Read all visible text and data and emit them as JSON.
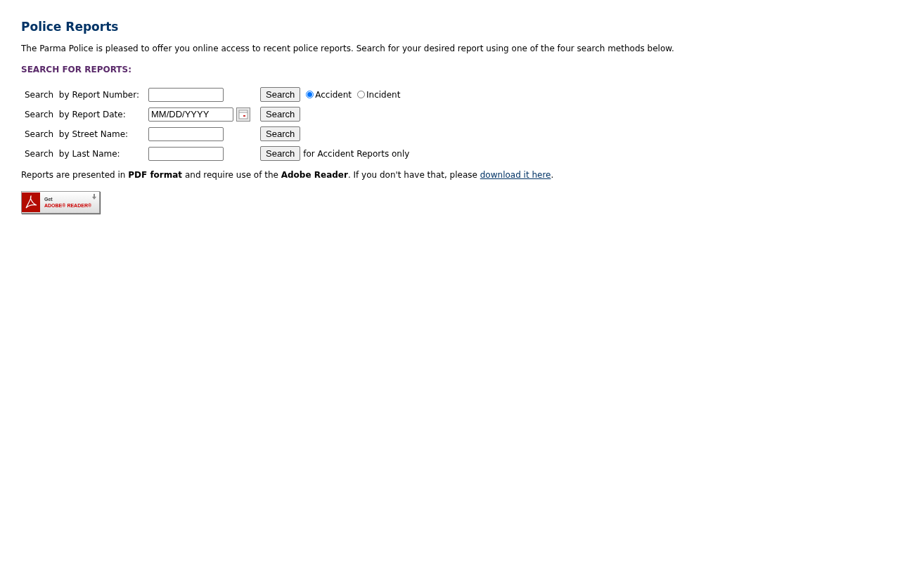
{
  "title": "Police Reports",
  "intro": "The Parma Police is pleased to offer you online access to recent police reports. Search for your desired report using one of the four search methods below.",
  "section_heading": "SEARCH FOR REPORTS:",
  "search_rows": [
    {
      "label": "Search  by Report Number:",
      "kind": "text",
      "button": "Search",
      "options": [
        {
          "label": "Accident",
          "selected": true
        },
        {
          "label": "Incident",
          "selected": false
        }
      ]
    },
    {
      "label": "Search  by Report Date:",
      "kind": "date",
      "value": "MM/DD/YYYY",
      "button": "Search"
    },
    {
      "label": "Search  by Street Name:",
      "kind": "text",
      "button": "Search"
    },
    {
      "label": "Search  by Last Name:",
      "kind": "text",
      "button": "Search",
      "note": "for Accident Reports only"
    }
  ],
  "notice": {
    "text": "Reports are presented in **PDF format** and require use of the **Adobe Reader**. If you don't have that, please ",
    "link": "download it here",
    "after": "."
  },
  "badge": {
    "line1": "Get",
    "line2": "ADOBE® READER®"
  }
}
